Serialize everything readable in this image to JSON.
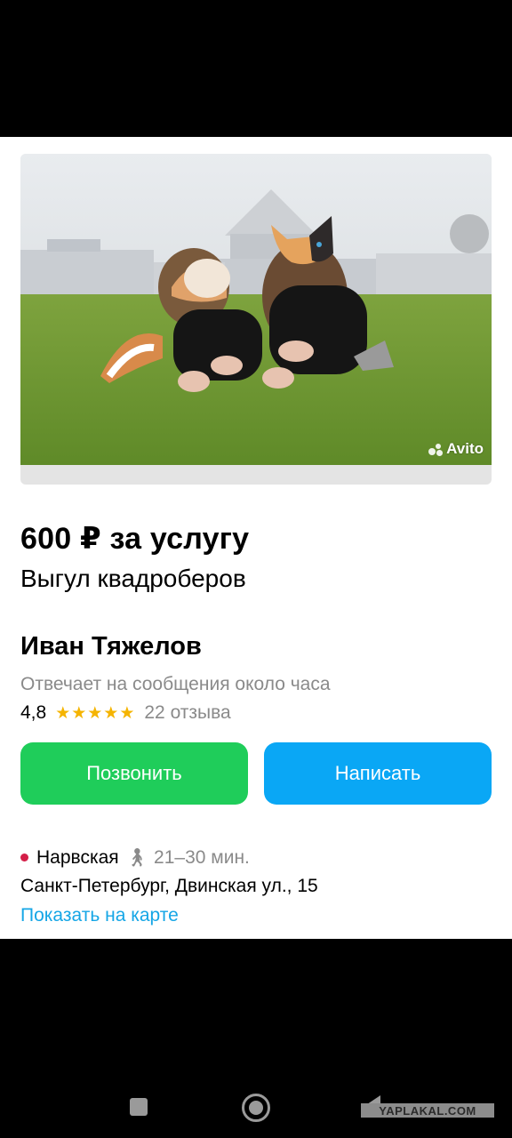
{
  "listing": {
    "price": "600 ₽ за услугу",
    "title": "Выгул квадроберов",
    "photo_watermark": "Avito"
  },
  "seller": {
    "name": "Иван Тяжелов",
    "reply_time": "Отвечает на сообщения около часа",
    "rating": "4,8",
    "stars": "★★★★★",
    "reviews": "22 отзыва"
  },
  "actions": {
    "call_label": "Позвонить",
    "write_label": "Написать"
  },
  "location": {
    "metro": "Нарвская",
    "walk_time": "21–30 мин.",
    "address": "Санкт-Петербург, Двинская ул., 15",
    "map_link": "Показать на карте",
    "metro_color": "#d41e48"
  },
  "colors": {
    "call_button": "#1fcd5a",
    "write_button": "#0aa7f5",
    "link": "#15a6e6",
    "star": "#f5b400"
  },
  "navbar": {
    "watermark": "YAPLAKAL.COM"
  },
  "icons": [
    "walk-icon",
    "recent-apps-icon",
    "home-icon",
    "back-icon",
    "avito-logo-icon"
  ]
}
